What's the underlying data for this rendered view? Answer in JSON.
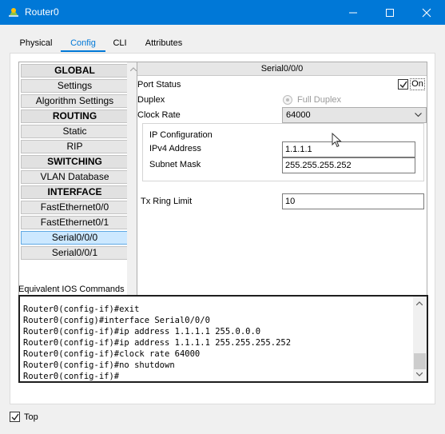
{
  "window": {
    "title": "Router0"
  },
  "tabs": [
    {
      "label": "Physical"
    },
    {
      "label": "Config"
    },
    {
      "label": "CLI"
    },
    {
      "label": "Attributes"
    }
  ],
  "nav": {
    "items": [
      {
        "label": "GLOBAL"
      },
      {
        "label": "Settings"
      },
      {
        "label": "Algorithm Settings"
      },
      {
        "label": "ROUTING"
      },
      {
        "label": "Static"
      },
      {
        "label": "RIP"
      },
      {
        "label": "SWITCHING"
      },
      {
        "label": "VLAN Database"
      },
      {
        "label": "INTERFACE"
      },
      {
        "label": "FastEthernet0/0"
      },
      {
        "label": "FastEthernet0/1"
      },
      {
        "label": "Serial0/0/0"
      },
      {
        "label": "Serial0/0/1"
      }
    ]
  },
  "interface": {
    "title": "Serial0/0/0",
    "port_status_label": "Port Status",
    "port_status_on": "On",
    "duplex_label": "Duplex",
    "duplex_value": "Full Duplex",
    "clock_rate_label": "Clock Rate",
    "clock_rate_value": "64000",
    "ip_config_label": "IP Configuration",
    "ipv4_label": "IPv4 Address",
    "ipv4_value": "1.1.1.1",
    "mask_label": "Subnet Mask",
    "mask_value": "255.255.255.252",
    "tx_ring_label": "Tx Ring Limit",
    "tx_ring_value": "10"
  },
  "ios": {
    "label": "Equivalent IOS Commands",
    "lines": [
      "Router0(config-if)#exit",
      "Router0(config)#interface Serial0/0/0",
      "Router0(config-if)#ip address 1.1.1.1 255.0.0.0",
      "Router0(config-if)#ip address 1.1.1.1 255.255.255.252",
      "Router0(config-if)#clock rate 64000",
      "Router0(config-if)#no shutdown",
      "Router0(config-if)#"
    ]
  },
  "footer": {
    "top_label": "Top"
  },
  "colors": {
    "titlebar": "#0078d7",
    "selected_item": "#cce8ff",
    "accent": "#0078d7"
  }
}
